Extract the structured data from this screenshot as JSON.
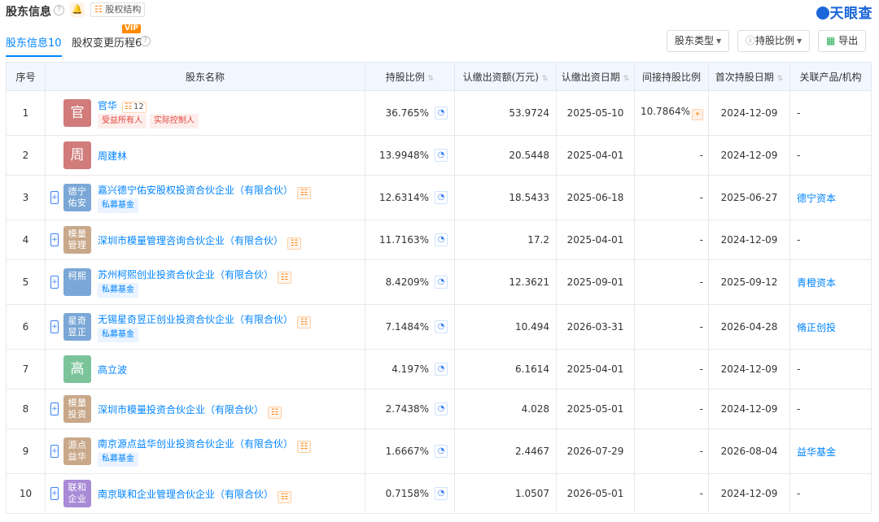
{
  "header": {
    "title": "股东信息",
    "equity_btn": "股权结构",
    "logo": "天眼查"
  },
  "tabs": [
    {
      "label": "股东信息",
      "count": "10"
    },
    {
      "label": "股权变更历程",
      "count": "6",
      "badge": "VIP"
    }
  ],
  "toolbar": {
    "type_filter": "股东类型",
    "ratio_filter": "持股比例",
    "export": "导出"
  },
  "columns": [
    "序号",
    "股东名称",
    "持股比例",
    "认缴出资额(万元)",
    "认缴出资日期",
    "间接持股比例",
    "首次持股日期",
    "关联产品/机构"
  ],
  "rows": [
    {
      "idx": "1",
      "avatar": "官",
      "avatar_color": "#d17b7b",
      "name": "官华",
      "control": "12",
      "tags": [
        "受益所有人",
        "实际控制人"
      ],
      "tag_color": "red",
      "ratio": "36.765%",
      "capital": "53.9724",
      "date": "2025-05-10",
      "indirect": "10.7864%",
      "first": "2024-12-09",
      "related": "-"
    },
    {
      "idx": "2",
      "avatar": "周",
      "avatar_color": "#d17b7b",
      "name": "周建林",
      "tags": [],
      "ratio": "13.9948%",
      "capital": "20.5448",
      "date": "2025-04-01",
      "indirect": "-",
      "first": "2024-12-09",
      "related": "-"
    },
    {
      "idx": "3",
      "avatar": "德宁佑安",
      "avatar_color": "#7aa7d6",
      "name": "嘉兴德宁佑安股权投资合伙企业（有限合伙）",
      "expand": true,
      "equity": true,
      "tags": [
        "私募基金"
      ],
      "tag_color": "blue",
      "ratio": "12.6314%",
      "capital": "18.5433",
      "date": "2025-06-18",
      "indirect": "-",
      "first": "2025-06-27",
      "related": "德宁资本"
    },
    {
      "idx": "4",
      "avatar": "模量管理",
      "avatar_color": "#c9a88a",
      "name": "深圳市模量管理咨询合伙企业（有限合伙）",
      "expand": true,
      "equity": true,
      "tags": [],
      "ratio": "11.7163%",
      "capital": "17.2",
      "date": "2025-04-01",
      "indirect": "-",
      "first": "2024-12-09",
      "related": "-"
    },
    {
      "idx": "5",
      "avatar": "柯熙",
      "avatar_color": "#7aa7d6",
      "name": "苏州柯熙创业投资合伙企业（有限合伙）",
      "expand": true,
      "equity": true,
      "tags": [
        "私募基金"
      ],
      "tag_color": "blue",
      "ratio": "8.4209%",
      "capital": "12.3621",
      "date": "2025-09-01",
      "indirect": "-",
      "first": "2025-09-12",
      "related": "青橙资本"
    },
    {
      "idx": "6",
      "avatar": "星奇昱正",
      "avatar_color": "#7aa7d6",
      "name": "无锡星奇昱正创业投资合伙企业（有限合伙）",
      "expand": true,
      "equity": true,
      "tags": [
        "私募基金"
      ],
      "tag_color": "blue",
      "ratio": "7.1484%",
      "capital": "10.494",
      "date": "2026-03-31",
      "indirect": "-",
      "first": "2026-04-28",
      "related": "脩正创投"
    },
    {
      "idx": "7",
      "avatar": "高",
      "avatar_color": "#7bc49a",
      "name": "高立波",
      "tags": [],
      "ratio": "4.197%",
      "capital": "6.1614",
      "date": "2025-04-01",
      "indirect": "-",
      "first": "2024-12-09",
      "related": "-"
    },
    {
      "idx": "8",
      "avatar": "模量投资",
      "avatar_color": "#c9a88a",
      "name": "深圳市模量投资合伙企业（有限合伙）",
      "expand": true,
      "equity": true,
      "tags": [],
      "ratio": "2.7438%",
      "capital": "4.028",
      "date": "2025-05-01",
      "indirect": "-",
      "first": "2024-12-09",
      "related": "-"
    },
    {
      "idx": "9",
      "avatar": "源点益华",
      "avatar_color": "#c9a88a",
      "name": "南京源点益华创业投资合伙企业（有限合伙）",
      "expand": true,
      "equity": true,
      "tags": [
        "私募基金"
      ],
      "tag_color": "blue",
      "ratio": "1.6667%",
      "capital": "2.4467",
      "date": "2026-07-29",
      "indirect": "-",
      "first": "2026-08-04",
      "related": "益华基金"
    },
    {
      "idx": "10",
      "avatar": "联和企业",
      "avatar_color": "#a98ad6",
      "name": "南京联和企业管理合伙企业（有限合伙）",
      "expand": true,
      "equity": true,
      "tags": [],
      "ratio": "0.7158%",
      "capital": "1.0507",
      "date": "2026-05-01",
      "indirect": "-",
      "first": "2024-12-09",
      "related": "-"
    }
  ],
  "row_heights": [
    55,
    49,
    55,
    49,
    55,
    55,
    49,
    49,
    55,
    49
  ]
}
